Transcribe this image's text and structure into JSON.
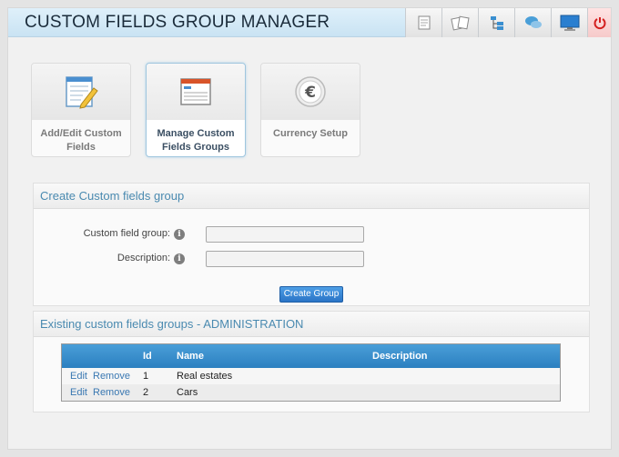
{
  "app": {
    "title": "CUSTOM FIELDS GROUP MANAGER"
  },
  "toolbar": {
    "buttons": [
      {
        "icon": "notepad-icon"
      },
      {
        "icon": "cards-icon"
      },
      {
        "icon": "sitemap-icon"
      },
      {
        "icon": "chat-icon"
      },
      {
        "icon": "monitor-icon"
      },
      {
        "icon": "power-icon"
      }
    ]
  },
  "tiles": [
    {
      "label": "Add/Edit Custom Fields",
      "icon": "edit-form-icon",
      "active": false
    },
    {
      "label": "Manage Custom Fields Groups",
      "icon": "window-list-icon",
      "active": true
    },
    {
      "label": "Currency Setup",
      "icon": "euro-icon",
      "active": false
    }
  ],
  "create_panel": {
    "title": "Create Custom fields group",
    "group_label": "Custom field group:",
    "group_value": "",
    "description_label": "Description:",
    "description_value": "",
    "button_label": "Create Group"
  },
  "existing_panel": {
    "title": "Existing custom fields groups - ADMINISTRATION",
    "columns": {
      "id": "Id",
      "name": "Name",
      "description": "Description"
    },
    "rows": [
      {
        "edit": "Edit",
        "remove": "Remove",
        "id": "1",
        "name": "Real estates",
        "description": ""
      },
      {
        "edit": "Edit",
        "remove": "Remove",
        "id": "2",
        "name": "Cars",
        "description": ""
      }
    ]
  },
  "colors": {
    "accent": "#2b7fc0",
    "header_text": "#4a8ab0",
    "power": "#d42020"
  }
}
